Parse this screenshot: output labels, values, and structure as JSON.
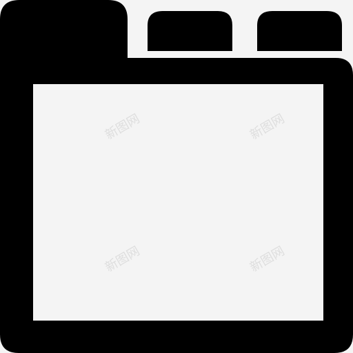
{
  "icon": {
    "name": "browser-tabs-window-icon",
    "color": "#000000",
    "background": "#f4f4f4",
    "tab_count": 3,
    "active_tab_index": 0
  },
  "watermark": {
    "text": "新图网"
  }
}
